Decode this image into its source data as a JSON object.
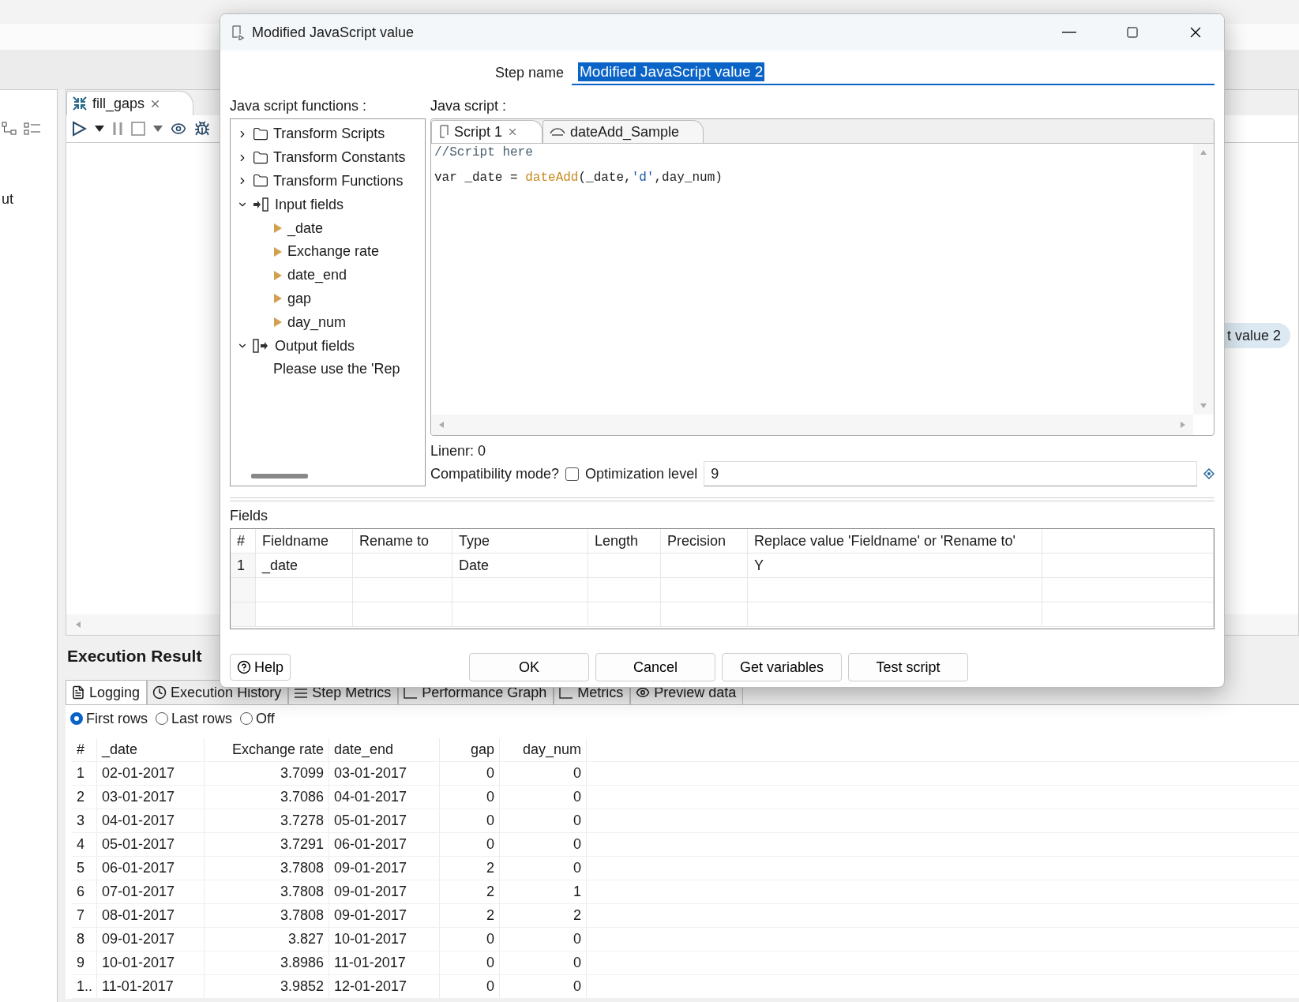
{
  "background": {
    "left_panel": {
      "text": "ut"
    },
    "editor_tab": {
      "label": "fill_gaps",
      "selected": true
    },
    "canvas_step_label": "t value 2",
    "results": {
      "title": "Execution Result",
      "tabs": [
        {
          "label": "Logging",
          "selected": true,
          "kind": "log"
        },
        {
          "label": "Execution History",
          "selected": false,
          "kind": "history"
        },
        {
          "label": "Step Metrics",
          "selected": false,
          "kind": "metrics"
        },
        {
          "label": "Performance Graph",
          "selected": false,
          "kind": "graph"
        },
        {
          "label": "Metrics",
          "selected": false,
          "kind": "graph"
        },
        {
          "label": "Preview data",
          "selected": false,
          "kind": "preview"
        }
      ],
      "radios": [
        {
          "label": "First rows",
          "selected": true
        },
        {
          "label": "Last rows",
          "selected": false
        },
        {
          "label": "Off",
          "selected": false
        }
      ],
      "columns": [
        "#",
        "_date",
        "Exchange rate",
        "date_end",
        "gap",
        "day_num"
      ],
      "rows": [
        [
          "1",
          "02-01-2017",
          "3.7099",
          "03-01-2017",
          "0",
          "0"
        ],
        [
          "2",
          "03-01-2017",
          "3.7086",
          "04-01-2017",
          "0",
          "0"
        ],
        [
          "3",
          "04-01-2017",
          "3.7278",
          "05-01-2017",
          "0",
          "0"
        ],
        [
          "4",
          "05-01-2017",
          "3.7291",
          "06-01-2017",
          "0",
          "0"
        ],
        [
          "5",
          "06-01-2017",
          "3.7808",
          "09-01-2017",
          "2",
          "0"
        ],
        [
          "6",
          "07-01-2017",
          "3.7808",
          "09-01-2017",
          "2",
          "1"
        ],
        [
          "7",
          "08-01-2017",
          "3.7808",
          "09-01-2017",
          "2",
          "2"
        ],
        [
          "8",
          "09-01-2017",
          "3.827",
          "10-01-2017",
          "0",
          "0"
        ],
        [
          "9",
          "10-01-2017",
          "3.8986",
          "11-01-2017",
          "0",
          "0"
        ],
        [
          "1..",
          "11-01-2017",
          "3.9852",
          "12-01-2017",
          "0",
          "0"
        ]
      ]
    }
  },
  "dialog": {
    "title": "Modified JavaScript value",
    "step_name": {
      "label": "Step name",
      "value": "Modified JavaScript value 2"
    },
    "functions_label": "Java script functions :",
    "tree": [
      {
        "label": "Transform Scripts",
        "kind": "folder",
        "expanded": false
      },
      {
        "label": "Transform Constants",
        "kind": "folder",
        "expanded": false
      },
      {
        "label": "Transform Functions",
        "kind": "folder",
        "expanded": false
      },
      {
        "label": "Input fields",
        "kind": "input",
        "expanded": true,
        "children": [
          {
            "label": "_date",
            "kind": "field"
          },
          {
            "label": "Exchange rate",
            "kind": "field"
          },
          {
            "label": "date_end",
            "kind": "field"
          },
          {
            "label": "gap",
            "kind": "field"
          },
          {
            "label": "day_num",
            "kind": "field"
          }
        ]
      },
      {
        "label": "Output fields",
        "kind": "output",
        "expanded": true,
        "children": [
          {
            "label": "Please use the 'Rep",
            "kind": "note"
          }
        ]
      }
    ],
    "script_label": "Java script :",
    "script_tabs": [
      {
        "label": "Script 1",
        "selected": true
      },
      {
        "label": "dateAdd_Sample",
        "selected": false
      }
    ],
    "code": [
      [
        {
          "text": "//Script here",
          "kind": "comment"
        }
      ],
      [
        {
          "text": "var _date = ",
          "kind": "plain"
        },
        {
          "text": "dateAdd",
          "kind": "function"
        },
        {
          "text": "(_date,",
          "kind": "plain"
        },
        {
          "text": "'d'",
          "kind": "string"
        },
        {
          "text": ",day_num)",
          "kind": "plain"
        }
      ]
    ],
    "line_number": "Linenr: 0",
    "compatibility": {
      "label": "Compatibility mode?",
      "checked": false
    },
    "optimization": {
      "label": "Optimization level",
      "value": "9"
    },
    "fields": {
      "label": "Fields",
      "columns": [
        "#",
        "Fieldname",
        "Rename to",
        "Type",
        "Length",
        "Precision",
        "Replace value 'Fieldname' or 'Rename to'"
      ],
      "rows": [
        [
          "1",
          "_date",
          null,
          "Date",
          null,
          null,
          "Y"
        ]
      ]
    },
    "buttons": [
      {
        "label": "Help",
        "kind": "help"
      },
      {
        "label": "OK",
        "kind": "action"
      },
      {
        "label": "Cancel",
        "kind": "action"
      },
      {
        "label": "Get variables",
        "kind": "action"
      },
      {
        "label": "Test script",
        "kind": "action"
      }
    ]
  }
}
